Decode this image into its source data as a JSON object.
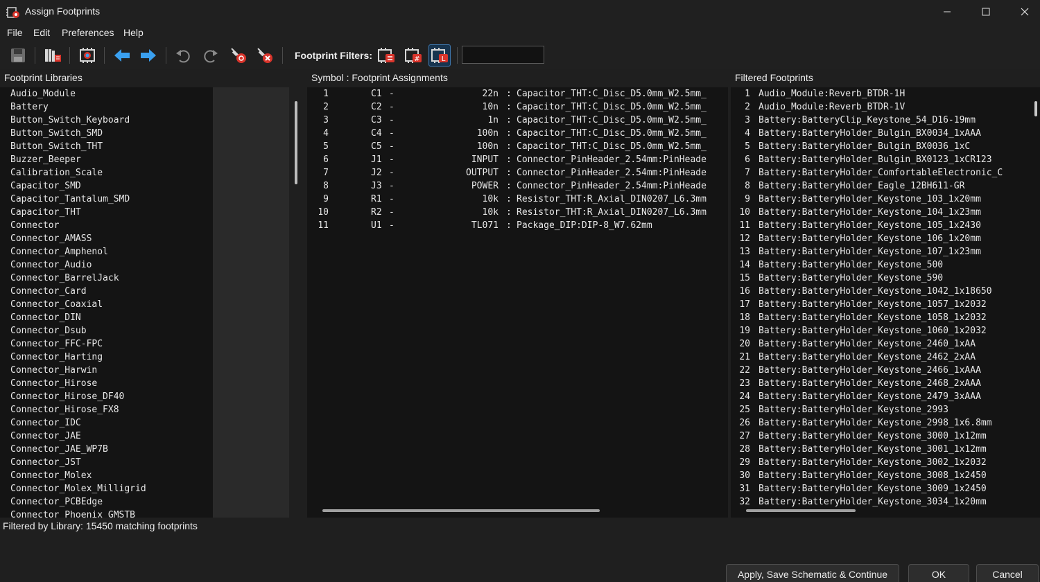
{
  "window": {
    "title": "Assign Footprints",
    "icons": {
      "app": "kicad-cvpcb-icon",
      "minimize": "minimize-icon",
      "maximize": "maximize-icon",
      "close": "close-icon"
    }
  },
  "menu": {
    "items": [
      "File",
      "Edit",
      "Preferences",
      "Help"
    ]
  },
  "toolbar": {
    "filters_label": "Footprint Filters:",
    "filter_text": "",
    "icons": [
      "save-icon",
      "library-manager-icon",
      "footprint-viewer-icon",
      "previous-unassigned-icon",
      "next-unassigned-icon",
      "undo-icon",
      "redo-icon",
      "auto-associate-icon",
      "delete-associations-icon",
      "filter-by-keywords-icon",
      "filter-by-pin-count-icon",
      "filter-by-library-icon"
    ],
    "colors": {
      "accent": "#3aa0f0",
      "active_filter": "#17344f"
    }
  },
  "libraries": {
    "header": "Footprint Libraries",
    "items": [
      "Audio_Module",
      "Battery",
      "Button_Switch_Keyboard",
      "Button_Switch_SMD",
      "Button_Switch_THT",
      "Buzzer_Beeper",
      "Calibration_Scale",
      "Capacitor_SMD",
      "Capacitor_Tantalum_SMD",
      "Capacitor_THT",
      "Connector",
      "Connector_AMASS",
      "Connector_Amphenol",
      "Connector_Audio",
      "Connector_BarrelJack",
      "Connector_Card",
      "Connector_Coaxial",
      "Connector_DIN",
      "Connector_Dsub",
      "Connector_FFC-FPC",
      "Connector_Harting",
      "Connector_Harwin",
      "Connector_Hirose",
      "Connector_Hirose_DF40",
      "Connector_Hirose_FX8",
      "Connector_IDC",
      "Connector_JAE",
      "Connector_JAE_WP7B",
      "Connector_JST",
      "Connector_Molex",
      "Connector_Molex_Milligrid",
      "Connector_PCBEdge",
      "Connector_Phoenix_GMSTB"
    ]
  },
  "assignments": {
    "header": "Symbol : Footprint Assignments",
    "rows": [
      {
        "num": "1",
        "ref": "C1",
        "dash": "-",
        "value": "22n",
        "colon": ":",
        "footprint": "Capacitor_THT:C_Disc_D5.0mm_W2.5mm_"
      },
      {
        "num": "2",
        "ref": "C2",
        "dash": "-",
        "value": "10n",
        "colon": ":",
        "footprint": "Capacitor_THT:C_Disc_D5.0mm_W2.5mm_"
      },
      {
        "num": "3",
        "ref": "C3",
        "dash": "-",
        "value": "1n",
        "colon": ":",
        "footprint": "Capacitor_THT:C_Disc_D5.0mm_W2.5mm_"
      },
      {
        "num": "4",
        "ref": "C4",
        "dash": "-",
        "value": "100n",
        "colon": ":",
        "footprint": "Capacitor_THT:C_Disc_D5.0mm_W2.5mm_"
      },
      {
        "num": "5",
        "ref": "C5",
        "dash": "-",
        "value": "100n",
        "colon": ":",
        "footprint": "Capacitor_THT:C_Disc_D5.0mm_W2.5mm_"
      },
      {
        "num": "6",
        "ref": "J1",
        "dash": "-",
        "value": "INPUT",
        "colon": ":",
        "footprint": "Connector_PinHeader_2.54mm:PinHeade"
      },
      {
        "num": "7",
        "ref": "J2",
        "dash": "-",
        "value": "OUTPUT",
        "colon": ":",
        "footprint": "Connector_PinHeader_2.54mm:PinHeade"
      },
      {
        "num": "8",
        "ref": "J3",
        "dash": "-",
        "value": "POWER",
        "colon": ":",
        "footprint": "Connector_PinHeader_2.54mm:PinHeade"
      },
      {
        "num": "9",
        "ref": "R1",
        "dash": "-",
        "value": "10k",
        "colon": ":",
        "footprint": "Resistor_THT:R_Axial_DIN0207_L6.3mm"
      },
      {
        "num": "10",
        "ref": "R2",
        "dash": "-",
        "value": "10k",
        "colon": ":",
        "footprint": "Resistor_THT:R_Axial_DIN0207_L6.3mm"
      },
      {
        "num": "11",
        "ref": "U1",
        "dash": "-",
        "value": "TL071",
        "colon": ":",
        "footprint": "Package_DIP:DIP-8_W7.62mm"
      }
    ]
  },
  "filtered": {
    "header": "Filtered Footprints",
    "rows": [
      {
        "num": "1",
        "name": "Audio_Module:Reverb_BTDR-1H"
      },
      {
        "num": "2",
        "name": "Audio_Module:Reverb_BTDR-1V"
      },
      {
        "num": "3",
        "name": "Battery:BatteryClip_Keystone_54_D16-19mm"
      },
      {
        "num": "4",
        "name": "Battery:BatteryHolder_Bulgin_BX0034_1xAAA"
      },
      {
        "num": "5",
        "name": "Battery:BatteryHolder_Bulgin_BX0036_1xC"
      },
      {
        "num": "6",
        "name": "Battery:BatteryHolder_Bulgin_BX0123_1xCR123"
      },
      {
        "num": "7",
        "name": "Battery:BatteryHolder_ComfortableElectronic_C"
      },
      {
        "num": "8",
        "name": "Battery:BatteryHolder_Eagle_12BH611-GR"
      },
      {
        "num": "9",
        "name": "Battery:BatteryHolder_Keystone_103_1x20mm"
      },
      {
        "num": "10",
        "name": "Battery:BatteryHolder_Keystone_104_1x23mm"
      },
      {
        "num": "11",
        "name": "Battery:BatteryHolder_Keystone_105_1x2430"
      },
      {
        "num": "12",
        "name": "Battery:BatteryHolder_Keystone_106_1x20mm"
      },
      {
        "num": "13",
        "name": "Battery:BatteryHolder_Keystone_107_1x23mm"
      },
      {
        "num": "14",
        "name": "Battery:BatteryHolder_Keystone_500"
      },
      {
        "num": "15",
        "name": "Battery:BatteryHolder_Keystone_590"
      },
      {
        "num": "16",
        "name": "Battery:BatteryHolder_Keystone_1042_1x18650"
      },
      {
        "num": "17",
        "name": "Battery:BatteryHolder_Keystone_1057_1x2032"
      },
      {
        "num": "18",
        "name": "Battery:BatteryHolder_Keystone_1058_1x2032"
      },
      {
        "num": "19",
        "name": "Battery:BatteryHolder_Keystone_1060_1x2032"
      },
      {
        "num": "20",
        "name": "Battery:BatteryHolder_Keystone_2460_1xAA"
      },
      {
        "num": "21",
        "name": "Battery:BatteryHolder_Keystone_2462_2xAA"
      },
      {
        "num": "22",
        "name": "Battery:BatteryHolder_Keystone_2466_1xAAA"
      },
      {
        "num": "23",
        "name": "Battery:BatteryHolder_Keystone_2468_2xAAA"
      },
      {
        "num": "24",
        "name": "Battery:BatteryHolder_Keystone_2479_3xAAA"
      },
      {
        "num": "25",
        "name": "Battery:BatteryHolder_Keystone_2993"
      },
      {
        "num": "26",
        "name": "Battery:BatteryHolder_Keystone_2998_1x6.8mm"
      },
      {
        "num": "27",
        "name": "Battery:BatteryHolder_Keystone_3000_1x12mm"
      },
      {
        "num": "28",
        "name": "Battery:BatteryHolder_Keystone_3001_1x12mm"
      },
      {
        "num": "29",
        "name": "Battery:BatteryHolder_Keystone_3002_1x2032"
      },
      {
        "num": "30",
        "name": "Battery:BatteryHolder_Keystone_3008_1x2450"
      },
      {
        "num": "31",
        "name": "Battery:BatteryHolder_Keystone_3009_1x2450"
      },
      {
        "num": "32",
        "name": "Battery:BatteryHolder_Keystone_3034_1x20mm"
      }
    ]
  },
  "status": {
    "text": "Filtered by Library: 15450 matching footprints"
  },
  "buttons": {
    "apply": "Apply, Save Schematic & Continue",
    "ok": "OK",
    "cancel": "Cancel"
  }
}
